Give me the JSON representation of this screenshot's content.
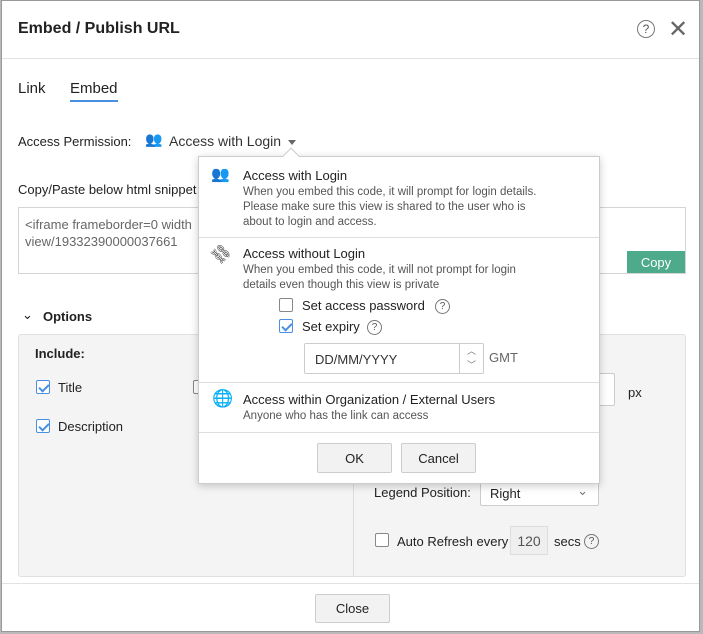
{
  "title": "Embed / Publish URL",
  "tabs": [
    "Link",
    "Embed"
  ],
  "access": {
    "label": "Access Permission:",
    "value": "Access with Login"
  },
  "snippet": {
    "label": "Copy/Paste below html snippet",
    "line1": "<iframe frameborder=0 width",
    "line2": "view/19332390000037661",
    "copy": "Copy"
  },
  "options": {
    "label": "Options",
    "include": "Include:",
    "title": "Title",
    "description": "Description",
    "px": "px",
    "legend_label": "Legend Position:",
    "legend_value": "Right",
    "auto_refresh": "Auto Refresh every",
    "refresh_value": "120",
    "secs": "secs"
  },
  "dropdown": {
    "login": {
      "title": "Access with Login",
      "desc": "When you embed this code, it will prompt for login details. Please make sure this view is shared to the user who is about to login and access."
    },
    "nologin": {
      "title": "Access without Login",
      "desc": "When you embed this code, it will not prompt for login details even though this view is private",
      "password": "Set access password",
      "expiry": "Set expiry",
      "date_placeholder": "DD/MM/YYYY",
      "gmt": "GMT"
    },
    "org": {
      "title": "Access within Organization / External Users",
      "desc": "Anyone who has the link can access"
    },
    "ok": "OK",
    "cancel": "Cancel"
  },
  "close": "Close",
  "colors": {
    "copy": "#4dab8b",
    "tab_underline": "#4a90e2"
  }
}
